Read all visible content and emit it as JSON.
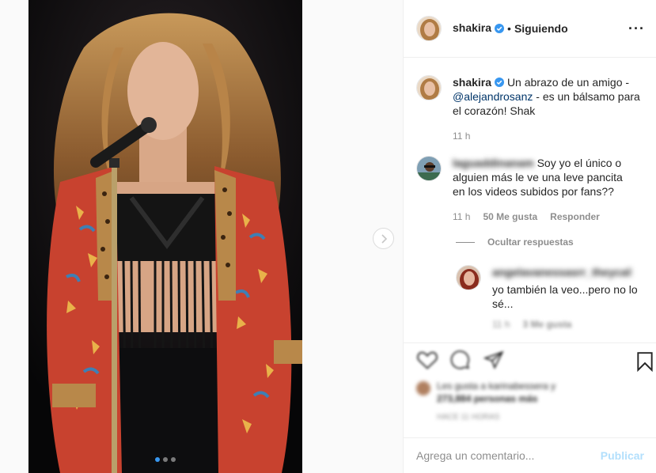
{
  "post": {
    "photo_icon": "concert-photo",
    "carousel_count": 3,
    "carousel_active_index": 0,
    "next_icon": "chevron-right-icon"
  },
  "header": {
    "username": "shakira",
    "separator": "•",
    "follow_state": "Siguiendo",
    "more_label": "···"
  },
  "caption": {
    "username": "shakira",
    "text_before": "Un abrazo de un amigo - ",
    "mention": "@alejandrosanz",
    "text_after": " - es un bálsamo para el corazón! Shak",
    "time": "11 h"
  },
  "comment": {
    "username": "laguaddinanam",
    "text": "Soy yo el único o alguien más le ve una leve pancita en los videos subidos por fans??",
    "time": "11 h",
    "likes": "50 Me gusta",
    "reply_label": "Responder",
    "hide_replies": "Ocultar respuestas"
  },
  "reply": {
    "username": "angelavanessasrr_theycallme",
    "text": "yo también la veo...pero no lo sé...",
    "time": "11 h",
    "likes": "3 Me gusta"
  },
  "likes_summary": {
    "line1": "Les gusta a karinabessera y",
    "line2": "273,884 personas más",
    "time": "HACE 11 HORAS"
  },
  "composer": {
    "placeholder": "Agrega un comentario...",
    "publish_label": "Publicar"
  },
  "colors": {
    "verified": "#3897f0",
    "link": "#003569",
    "publish_disabled": "#b2dffc",
    "muted": "#8e8e8e"
  }
}
